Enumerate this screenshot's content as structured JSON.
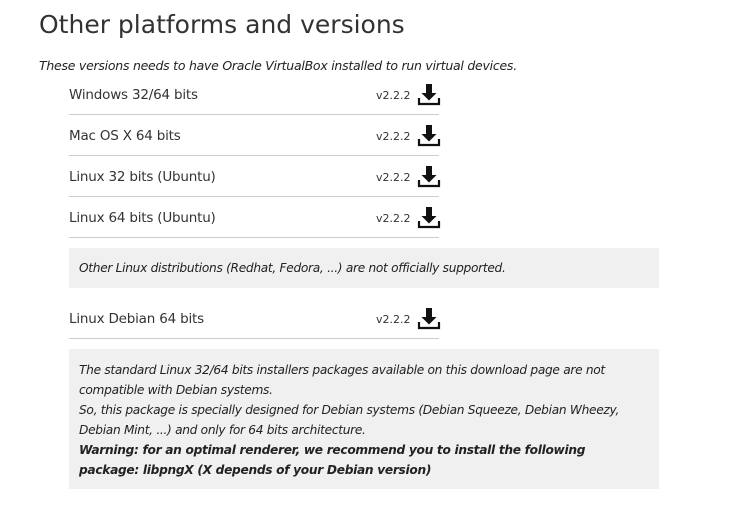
{
  "section": {
    "title": "Other platforms and versions",
    "intro": "These versions needs to have Oracle VirtualBox installed to run virtual devices."
  },
  "downloads": [
    {
      "name": "Windows 32/64 bits",
      "version": "v2.2.2",
      "icon": "download-icon"
    },
    {
      "name": "Mac OS X 64 bits",
      "version": "v2.2.2",
      "icon": "download-icon"
    },
    {
      "name": "Linux 32 bits (Ubuntu)",
      "version": "v2.2.2",
      "icon": "download-icon"
    },
    {
      "name": "Linux 64 bits (Ubuntu)",
      "version": "v2.2.2",
      "icon": "download-icon"
    }
  ],
  "linux_notice": "Other Linux distributions (Redhat, Fedora, ...) are not officially supported.",
  "debian": {
    "name": "Linux Debian 64 bits",
    "version": "v2.2.2",
    "icon": "download-icon"
  },
  "debian_notice": {
    "line1": "The standard Linux 32/64 bits installers packages available on this download page are not compatible with Debian systems.",
    "line2": "So, this package is specially designed for Debian systems (Debian Squeeze, Debian Wheezy, Debian Mint, ...) and only for 64 bits architecture.",
    "warning": "Warning: for an optimal renderer, we recommend you to install the following package: libpngX (X depends of your Debian version)"
  },
  "colors": {
    "text": "#333333",
    "notice_background": "#f0f0f0",
    "divider": "#cccccc",
    "icon": "#111111"
  }
}
